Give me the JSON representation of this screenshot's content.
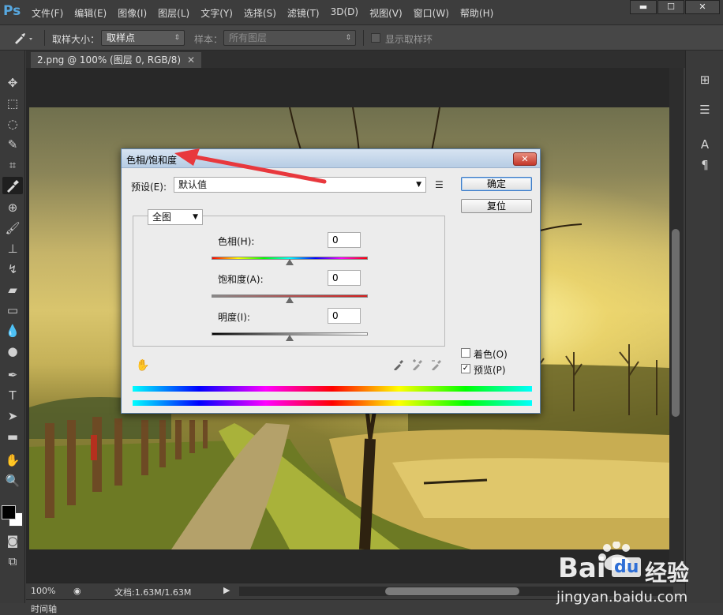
{
  "app": {
    "logo": "Ps"
  },
  "menu": [
    "文件(F)",
    "编辑(E)",
    "图像(I)",
    "图层(L)",
    "文字(Y)",
    "选择(S)",
    "滤镜(T)",
    "3D(D)",
    "视图(V)",
    "窗口(W)",
    "帮助(H)"
  ],
  "window_controls": {
    "minimize": "▬",
    "maximize": "☐",
    "close": "✕"
  },
  "options": {
    "sample_size_label": "取样大小：",
    "sample_size_value": "取样点",
    "sample_label": "样本：",
    "sample_value": "所有图层",
    "show_ring_label": "显示取样环"
  },
  "document": {
    "tab_title": "2.png @ 100% (图层 0, RGB/8)",
    "tab_close": "✕"
  },
  "status": {
    "zoom": "100%",
    "docinfo": "文档:1.63M/1.63M"
  },
  "timeline": {
    "label": "时间轴"
  },
  "dialog": {
    "title": "色相/饱和度",
    "close": "✕",
    "preset_label": "预设(E):",
    "preset_value": "默认值",
    "ok": "确定",
    "reset": "复位",
    "channel": "全图",
    "hue_label": "色相(H):",
    "hue_value": "0",
    "saturation_label": "饱和度(A):",
    "saturation_value": "0",
    "lightness_label": "明度(I):",
    "lightness_value": "0",
    "colorize_label": "着色(O)",
    "colorize_checked": false,
    "preview_label": "预览(P)",
    "preview_checked": true
  },
  "watermark": {
    "brand": "Bai",
    "brand_cn": "经验",
    "url": "jingyan.baidu.com"
  },
  "colors": {
    "annotation_arrow": "#e8383d",
    "dialog_title": "#c9dbee"
  }
}
